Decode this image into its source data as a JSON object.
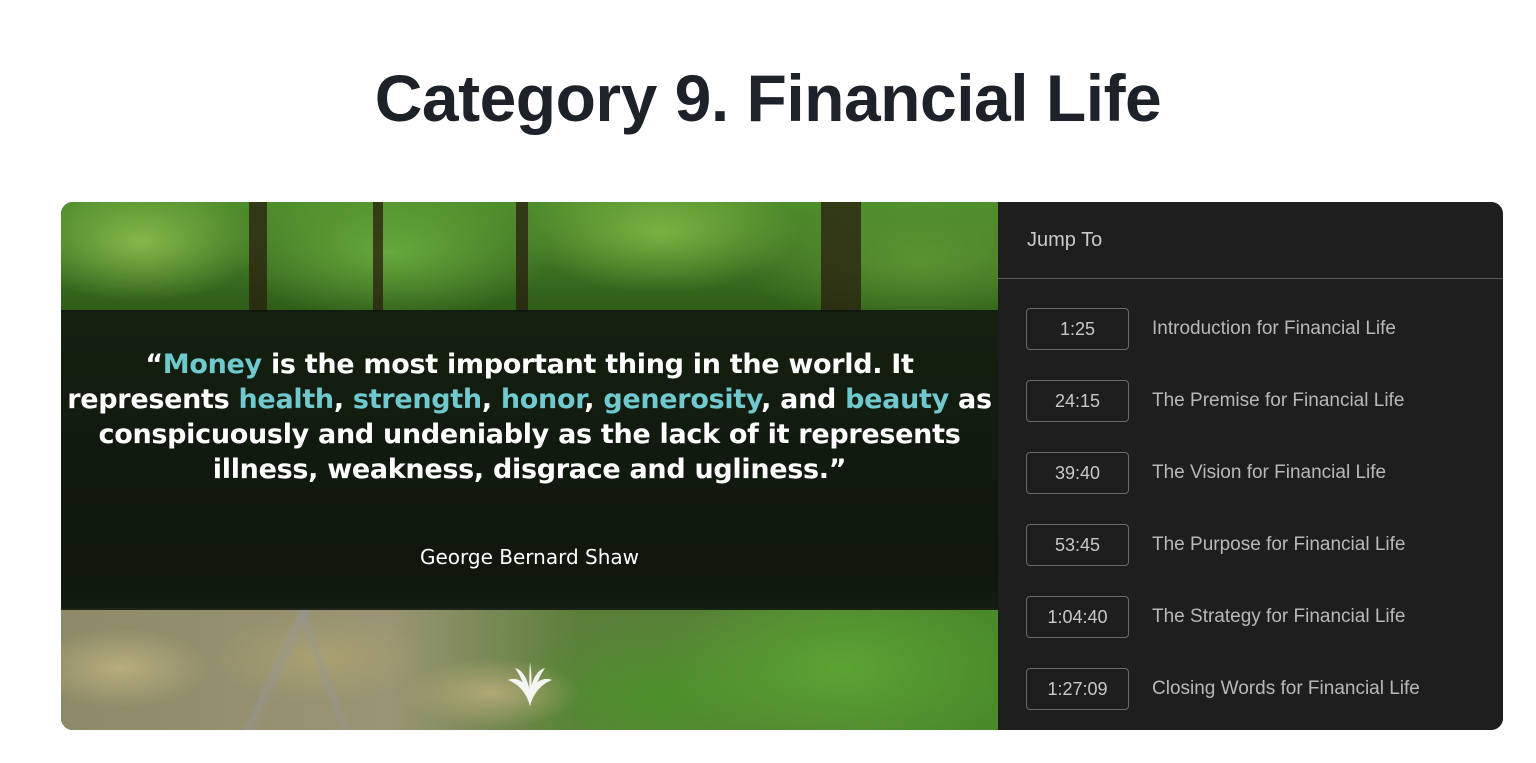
{
  "page": {
    "title": "Category 9. Financial Life"
  },
  "video": {
    "quote": {
      "segments": [
        {
          "text": "“",
          "highlight": false
        },
        {
          "text": "Money",
          "highlight": true
        },
        {
          "text": " is the most important thing in the world. It represents ",
          "highlight": false
        },
        {
          "text": "health",
          "highlight": true
        },
        {
          "text": ", ",
          "highlight": false
        },
        {
          "text": "strength",
          "highlight": true
        },
        {
          "text": ", ",
          "highlight": false
        },
        {
          "text": "honor",
          "highlight": true
        },
        {
          "text": ", ",
          "highlight": false
        },
        {
          "text": "generosity",
          "highlight": true
        },
        {
          "text": ", and ",
          "highlight": false
        },
        {
          "text": "beauty",
          "highlight": true
        },
        {
          "text": " as conspicuously and undeniably as the lack of it represents illness, weakness, disgrace and ugliness.”",
          "highlight": false
        }
      ]
    },
    "author": "George Bernard Shaw",
    "logo_icon": "fan-leaf-logo-icon",
    "highlight_color": "#6fc9cf"
  },
  "sidebar": {
    "header": "Jump To",
    "chapters": [
      {
        "time": "1:25",
        "title": "Introduction for Financial Life"
      },
      {
        "time": "24:15",
        "title": "The Premise for Financial Life"
      },
      {
        "time": "39:40",
        "title": "The Vision for Financial Life"
      },
      {
        "time": "53:45",
        "title": "The Purpose for Financial Life"
      },
      {
        "time": "1:04:40",
        "title": "The Strategy for Financial Life"
      },
      {
        "time": "1:27:09",
        "title": "Closing Words for Financial Life"
      }
    ]
  }
}
